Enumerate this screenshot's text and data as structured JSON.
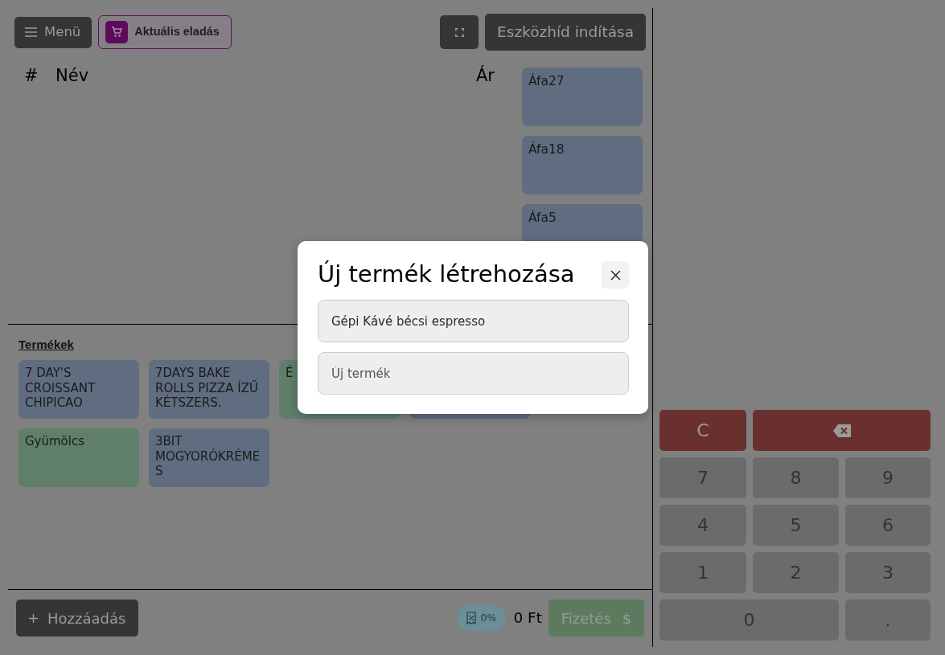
{
  "toolbar": {
    "menu_button": {
      "label": "Menü"
    },
    "sale_button": {
      "label": "Aktuális eladás",
      "active": true
    },
    "bridge_button": {
      "label": "Eszközhíd indítása"
    }
  },
  "cart": {
    "columns": [
      "#",
      "Név",
      "Ár"
    ]
  },
  "vat_groups": [
    {
      "label": "Áfa27"
    },
    {
      "label": "Áfa18"
    },
    {
      "label": "Áfa5"
    }
  ],
  "products": {
    "title": "Termékek",
    "items": [
      {
        "label": "7 DAY'S CROISSANT CHIPICAO",
        "color": "#606d80"
      },
      {
        "label": "7DAYS BAKE ROLLS PIZZA ÍZŰ KÉTSZERS.",
        "color": "#606d80"
      },
      {
        "label": "É",
        "color": "#5f7f6a"
      },
      {
        "color": "#606d80"
      },
      {
        "label": "Gyümölcs",
        "color": "#5f7f6a"
      },
      {
        "label": "3BIT MOGYORÓKRÉMES",
        "color": "#606d80"
      }
    ]
  },
  "footer": {
    "add_button": {
      "label": "Hozzáadás"
    },
    "vat_badge": {
      "label": "0%"
    },
    "total": "0 Ft",
    "pay_button": {
      "label": "Fizetés",
      "icon": "$",
      "disabled": true
    }
  },
  "numpad": [
    {
      "kind": "clear",
      "label": "C"
    },
    {
      "kind": "backspace"
    },
    {
      "kind": "key",
      "label": "7"
    },
    {
      "kind": "key",
      "label": "8"
    },
    {
      "kind": "key",
      "label": "9"
    },
    {
      "kind": "key",
      "label": "4"
    },
    {
      "kind": "key",
      "label": "5"
    },
    {
      "kind": "key",
      "label": "6"
    },
    {
      "kind": "key",
      "label": "1"
    },
    {
      "kind": "key",
      "label": "2"
    },
    {
      "kind": "key",
      "label": "3"
    },
    {
      "kind": "wide",
      "label": "0"
    },
    {
      "kind": "key",
      "label": "."
    }
  ],
  "modal": {
    "title": "Új termék létrehozása",
    "fields": [
      {
        "value": "Gépi Kávé bécsi espresso"
      },
      {
        "placeholder": "Új termék"
      }
    ]
  }
}
